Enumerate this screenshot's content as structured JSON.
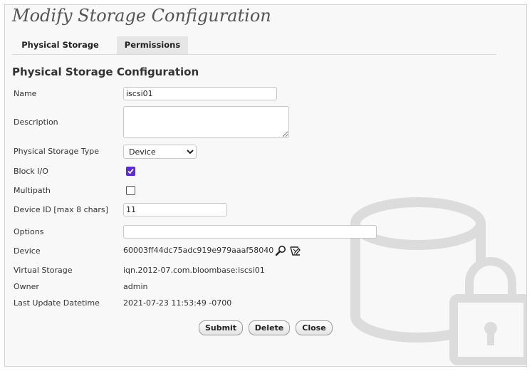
{
  "page": {
    "title": "Modify Storage Configuration"
  },
  "tabs": [
    {
      "label": "Physical Storage",
      "active": true
    },
    {
      "label": "Permissions",
      "active": false
    }
  ],
  "section": {
    "title": "Physical Storage Configuration"
  },
  "form": {
    "name": {
      "label": "Name",
      "value": "iscsi01"
    },
    "description": {
      "label": "Description",
      "value": ""
    },
    "storage_type": {
      "label": "Physical Storage Type",
      "value": "Device",
      "options": [
        "Device"
      ]
    },
    "block_io": {
      "label": "Block I/O",
      "checked": true
    },
    "multipath": {
      "label": "Multipath",
      "checked": false
    },
    "device_id": {
      "label": "Device ID [max 8 chars]",
      "value": "11"
    },
    "options": {
      "label": "Options",
      "value": ""
    },
    "device": {
      "label": "Device",
      "value": "60003ff44dc75adc919e979aaaf58040"
    },
    "virtual_storage": {
      "label": "Virtual Storage",
      "value": "iqn.2012-07.com.bloombase:iscsi01"
    },
    "owner": {
      "label": "Owner",
      "value": "admin"
    },
    "last_update": {
      "label": "Last Update Datetime",
      "value": "2021-07-23 11:53:49 -0700"
    }
  },
  "buttons": {
    "submit": "Submit",
    "delete": "Delete",
    "close": "Close"
  },
  "icons": {
    "device_search": "magnifier-icon",
    "device_clear": "eraser-icon",
    "watermark": "locked-storage-icon"
  },
  "colors": {
    "checkbox_accent": "#5b2bd6",
    "watermark": "#dcdcdc"
  }
}
